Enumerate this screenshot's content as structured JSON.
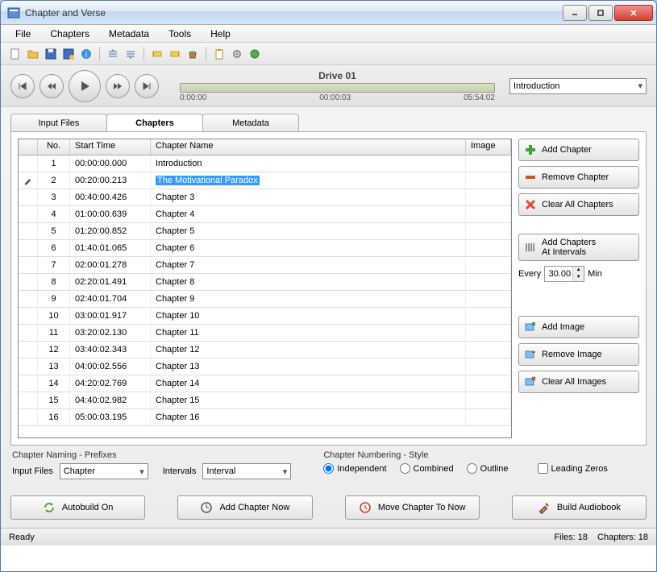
{
  "window": {
    "title": "Chapter and Verse"
  },
  "menu": [
    "File",
    "Chapters",
    "Metadata",
    "Tools",
    "Help"
  ],
  "player": {
    "track_title": "Drive 01",
    "time_start": "0:00:00",
    "time_mid": "00:00:03",
    "time_end": "05:54:02",
    "combo": "Introduction"
  },
  "tabs": {
    "input_files": "Input Files",
    "chapters": "Chapters",
    "metadata": "Metadata"
  },
  "table": {
    "headers": {
      "no": "No.",
      "start": "Start Time",
      "name": "Chapter Name",
      "image": "Image"
    },
    "rows": [
      {
        "no": "1",
        "start": "00:00:00.000",
        "name": "Introduction",
        "editing": false
      },
      {
        "no": "2",
        "start": "00:20:00.213",
        "name": "The Motivational Paradox",
        "editing": true
      },
      {
        "no": "3",
        "start": "00:40:00.426",
        "name": "Chapter 3",
        "editing": false
      },
      {
        "no": "4",
        "start": "01:00:00.639",
        "name": "Chapter 4",
        "editing": false
      },
      {
        "no": "5",
        "start": "01:20:00.852",
        "name": "Chapter 5",
        "editing": false
      },
      {
        "no": "6",
        "start": "01:40:01.065",
        "name": "Chapter 6",
        "editing": false
      },
      {
        "no": "7",
        "start": "02:00:01.278",
        "name": "Chapter 7",
        "editing": false
      },
      {
        "no": "8",
        "start": "02:20:01.491",
        "name": "Chapter 8",
        "editing": false
      },
      {
        "no": "9",
        "start": "02:40:01.704",
        "name": "Chapter 9",
        "editing": false
      },
      {
        "no": "10",
        "start": "03:00:01.917",
        "name": "Chapter 10",
        "editing": false
      },
      {
        "no": "11",
        "start": "03:20:02.130",
        "name": "Chapter 11",
        "editing": false
      },
      {
        "no": "12",
        "start": "03:40:02.343",
        "name": "Chapter 12",
        "editing": false
      },
      {
        "no": "13",
        "start": "04:00:02.556",
        "name": "Chapter 13",
        "editing": false
      },
      {
        "no": "14",
        "start": "04:20:02.769",
        "name": "Chapter 14",
        "editing": false
      },
      {
        "no": "15",
        "start": "04:40:02.982",
        "name": "Chapter 15",
        "editing": false
      },
      {
        "no": "16",
        "start": "05:00:03.195",
        "name": "Chapter 16",
        "editing": false
      }
    ]
  },
  "side": {
    "add_chapter": "Add Chapter",
    "remove_chapter": "Remove Chapter",
    "clear_chapters": "Clear All Chapters",
    "add_intervals_l1": "Add Chapters",
    "add_intervals_l2": "At Intervals",
    "every": "Every",
    "interval_value": "30.00",
    "min": "Min",
    "add_image": "Add Image",
    "remove_image": "Remove Image",
    "clear_images": "Clear All Images"
  },
  "naming": {
    "section": "Chapter Naming - Prefixes",
    "input_files_label": "Input Files",
    "input_files_value": "Chapter",
    "intervals_label": "Intervals",
    "intervals_value": "Interval"
  },
  "numbering": {
    "section": "Chapter Numbering - Style",
    "independent": "Independent",
    "combined": "Combined",
    "outline": "Outline",
    "leading_zeros": "Leading Zeros"
  },
  "actions": {
    "autobuild": "Autobuild On",
    "add_now": "Add Chapter Now",
    "move_now": "Move Chapter To Now",
    "build": "Build Audiobook"
  },
  "status": {
    "ready": "Ready",
    "files": "Files: 18",
    "chapters": "Chapters: 18"
  }
}
